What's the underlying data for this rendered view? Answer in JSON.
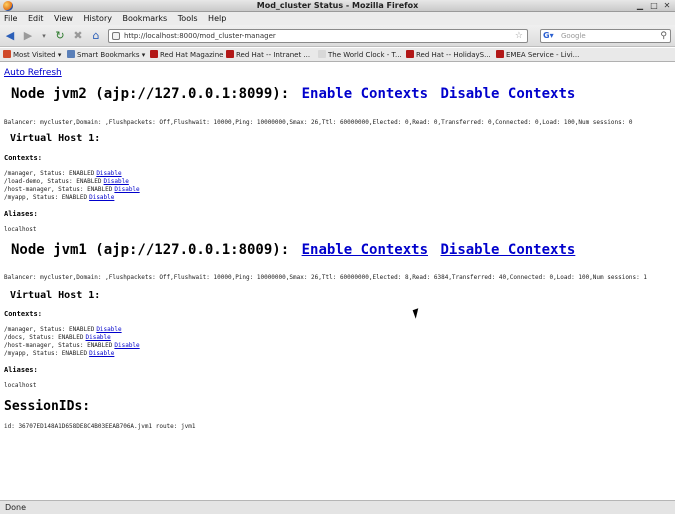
{
  "window": {
    "title": "Mod_cluster Status - Mozilla Firefox"
  },
  "menu": [
    "File",
    "Edit",
    "View",
    "History",
    "Bookmarks",
    "Tools",
    "Help"
  ],
  "address": {
    "url": "http://localhost:8000/mod_cluster-manager"
  },
  "search": {
    "placeholder": "Google"
  },
  "bookmarks": [
    {
      "label": "Most Visited",
      "color": "#d04a2a"
    },
    {
      "label": "Smart Bookmarks",
      "color": "#5a7fb8"
    },
    {
      "label": "Red Hat Magazine",
      "color": "#b21818"
    },
    {
      "label": "Red Hat -- Intranet ...",
      "color": "#b21818"
    },
    {
      "label": "The World Clock - T...",
      "color": "#d8d8d8"
    },
    {
      "label": "Red Hat -- HolidayS...",
      "color": "#b21818"
    },
    {
      "label": "EMEA Service - Livi...",
      "color": "#b21818"
    }
  ],
  "page": {
    "auto_refresh": "Auto Refresh",
    "nodes": [
      {
        "title": "Node jvm2 (ajp://127.0.0.1:8099):",
        "enable": "Enable Contexts",
        "disable": "Disable Contexts",
        "balancer": "Balancer: mycluster,Domain: ,Flushpackets: Off,Flushwait: 10000,Ping: 10000000,Smax: 26,Ttl: 60000000,Elected: 0,Read: 0,Transferred: 0,Connected: 0,Load: 100,Num sessions: 0",
        "vhost": "Virtual Host 1:",
        "contexts_label": "Contexts:",
        "contexts": [
          {
            "text": "/manager, Status: ENABLED",
            "link": "Disable"
          },
          {
            "text": "/load-demo, Status: ENABLED",
            "link": "Disable"
          },
          {
            "text": "/host-manager, Status: ENABLED",
            "link": "Disable"
          },
          {
            "text": "/myapp, Status: ENABLED",
            "link": "Disable"
          }
        ],
        "aliases_label": "Aliases:",
        "alias": "localhost"
      },
      {
        "title": "Node jvm1 (ajp://127.0.0.1:8009):",
        "enable": "Enable Contexts",
        "disable": "Disable Contexts",
        "balancer": "Balancer: mycluster,Domain: ,Flushpackets: Off,Flushwait: 10000,Ping: 10000000,Smax: 26,Ttl: 60000000,Elected: 8,Read: 6384,Transferred: 40,Connected: 0,Load: 100,Num sessions: 1",
        "vhost": "Virtual Host 1:",
        "contexts_label": "Contexts:",
        "contexts": [
          {
            "text": "/manager, Status: ENABLED",
            "link": "Disable"
          },
          {
            "text": "/docs, Status: ENABLED",
            "link": "Disable"
          },
          {
            "text": "/host-manager, Status: ENABLED",
            "link": "Disable"
          },
          {
            "text": "/myapp, Status: ENABLED",
            "link": "Disable"
          }
        ],
        "aliases_label": "Aliases:",
        "alias": "localhost"
      }
    ],
    "session_heading": "SessionIDs:",
    "session_line": "id: 36707ED148A1D658DE8C4B03EEAB706A.jvm1 route: jvm1"
  },
  "status": "Done"
}
